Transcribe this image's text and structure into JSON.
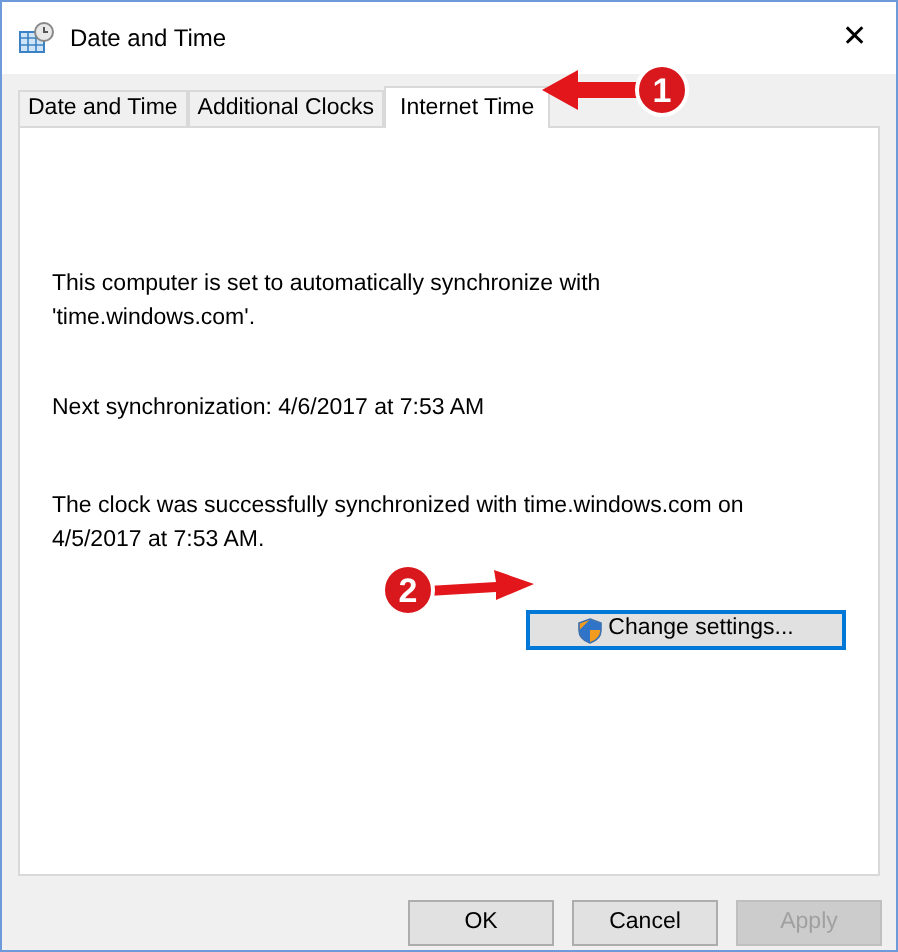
{
  "window": {
    "title": "Date and Time",
    "close": "✕"
  },
  "tabs": [
    {
      "label": "Date and Time",
      "selected": false
    },
    {
      "label": "Additional Clocks",
      "selected": false
    },
    {
      "label": "Internet Time",
      "selected": true
    }
  ],
  "panel": {
    "paragraphs": [
      "This computer is set to automatically synchronize with 'time.windows.com'.",
      "Next synchronization: 4/6/2017 at 7:53 AM",
      "The clock was successfully synchronized with time.windows.com on 4/5/2017 at 7:53 AM."
    ],
    "button": {
      "label": "Change settings...",
      "shield": true
    }
  },
  "buttons": [
    {
      "label": "OK",
      "disabled": false
    },
    {
      "label": "Cancel",
      "disabled": false
    },
    {
      "label": "Apply",
      "disabled": true
    }
  ],
  "annotations": [
    {
      "label": "1"
    },
    {
      "label": "2"
    }
  ]
}
